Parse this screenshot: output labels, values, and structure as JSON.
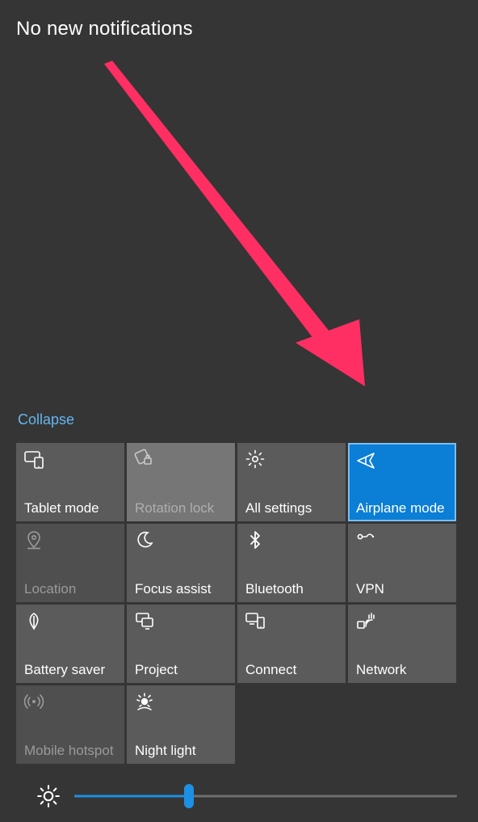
{
  "header": {
    "notifications_text": "No new notifications"
  },
  "collapse_label": "Collapse",
  "accent_color": "#0b7ed6",
  "annotation_color": "#ff2e63",
  "tiles": [
    {
      "key": "tablet-mode",
      "label": "Tablet mode",
      "state": "normal"
    },
    {
      "key": "rotation-lock",
      "label": "Rotation lock",
      "state": "muted"
    },
    {
      "key": "all-settings",
      "label": "All settings",
      "state": "normal"
    },
    {
      "key": "airplane-mode",
      "label": "Airplane mode",
      "state": "active"
    },
    {
      "key": "location",
      "label": "Location",
      "state": "disabled"
    },
    {
      "key": "focus-assist",
      "label": "Focus assist",
      "state": "normal"
    },
    {
      "key": "bluetooth",
      "label": "Bluetooth",
      "state": "normal"
    },
    {
      "key": "vpn",
      "label": "VPN",
      "state": "normal"
    },
    {
      "key": "battery-saver",
      "label": "Battery saver",
      "state": "normal"
    },
    {
      "key": "project",
      "label": "Project",
      "state": "normal"
    },
    {
      "key": "connect",
      "label": "Connect",
      "state": "normal"
    },
    {
      "key": "network",
      "label": "Network",
      "state": "normal"
    },
    {
      "key": "mobile-hotspot",
      "label": "Mobile hotspot",
      "state": "disabled"
    },
    {
      "key": "night-light",
      "label": "Night light",
      "state": "normal"
    }
  ],
  "brightness": {
    "value": 30,
    "min": 0,
    "max": 100
  }
}
